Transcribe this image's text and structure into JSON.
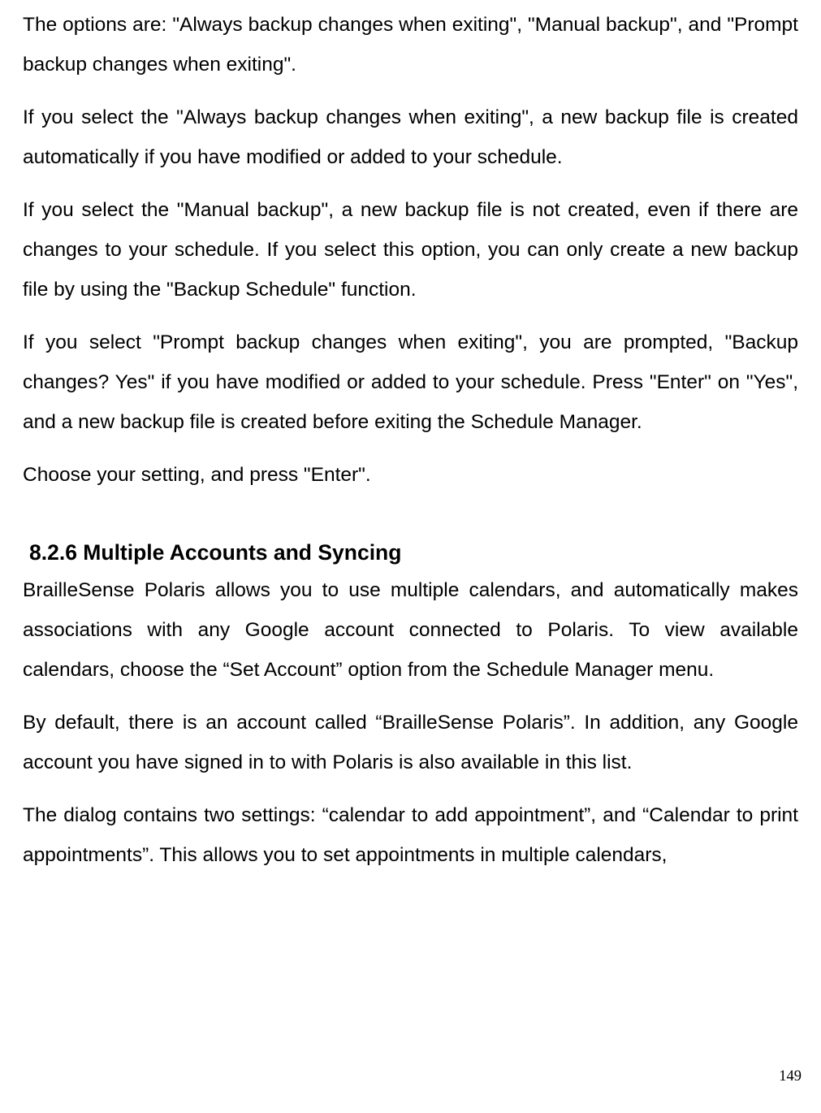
{
  "paragraphs": {
    "p1": "The options are: \"Always backup changes when exiting\", \"Manual backup\", and \"Prompt backup changes when exiting\".",
    "p2": "If you select the \"Always backup changes when exiting\", a new backup file is created automatically if you have modified or added to your schedule.",
    "p3": "If you select the \"Manual backup\", a new backup file is not created, even if there are changes to your schedule. If you select this option, you can only create a new backup file by using the \"Backup Schedule\" function.",
    "p4": "If you select \"Prompt backup changes when exiting\", you are prompted, \"Backup changes? Yes\" if you have modified or added to your schedule. Press \"Enter\" on \"Yes\", and a new backup file is created before exiting the Schedule Manager.",
    "p5": "Choose your setting, and press \"Enter\"."
  },
  "heading": "8.2.6 Multiple Accounts and Syncing",
  "paragraphs2": {
    "p6": "BrailleSense Polaris allows you to use multiple calendars, and automatically makes associations with any Google account connected to Polaris. To view available calendars, choose the “Set Account” option from the Schedule Manager menu.",
    "p7": "By default, there is an account called “BrailleSense Polaris”. In addition, any Google account you have signed in to with Polaris is also available in this list.",
    "p8": "The dialog contains two settings: “calendar to add appointment”, and “Calendar to print appointments”. This allows you to set appointments in multiple calendars,"
  },
  "page_number": "149"
}
